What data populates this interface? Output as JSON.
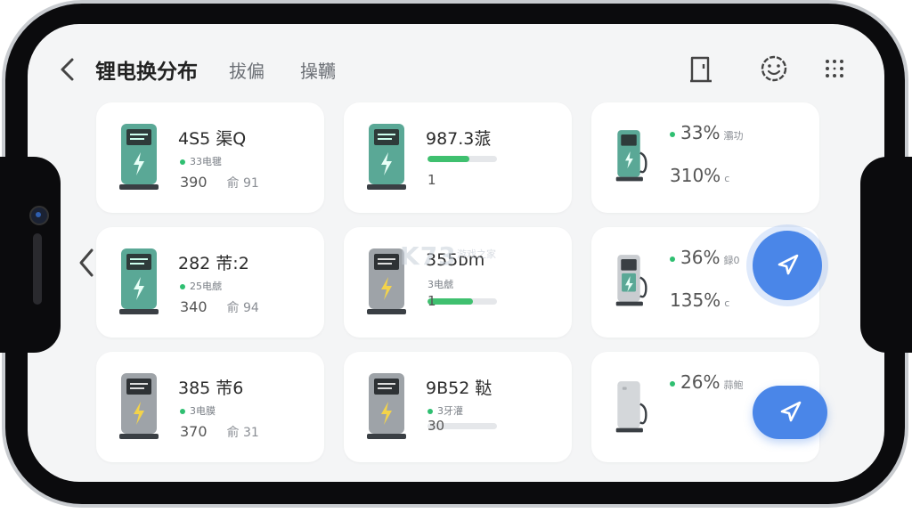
{
  "header": {
    "title": "锂电换分布",
    "tabs": [
      "拔偏",
      "操韉"
    ]
  },
  "cards": [
    {
      "name": "4S5 渠Q",
      "sub": "33电毽",
      "foot_a": "390",
      "foot_b": "俞 91"
    },
    {
      "name": "987.3蒎",
      "bar_pct": 60,
      "num": "1"
    },
    {
      "pct": "33%",
      "pct_sub": "灞功",
      "big": "310%",
      "big_sub": "c"
    },
    {
      "name": "282 芾:2",
      "sub": "25电虤",
      "foot_a": "340",
      "foot_b": "俞 94"
    },
    {
      "name": "355ᴅm",
      "sub": "3电虤",
      "bar_pct": 65,
      "num": "1"
    },
    {
      "pct": "36%",
      "pct_sub": "録0",
      "big": "135%",
      "big_sub": "c"
    },
    {
      "name": "385 芾6",
      "sub": "3电膜",
      "foot_a": "370",
      "foot_b": "俞 31"
    },
    {
      "name": "9B52 鞑",
      "sub": "3牙灌",
      "bar_pct": 0,
      "num": "30"
    },
    {
      "pct": "26%",
      "pct_sub": "蒜鲍"
    }
  ],
  "watermark": {
    "logo": "K73",
    "text": "游戏之家"
  },
  "colors": {
    "accent": "#4a86e8",
    "status": "#2fbf71",
    "teal": "#5aa896"
  }
}
